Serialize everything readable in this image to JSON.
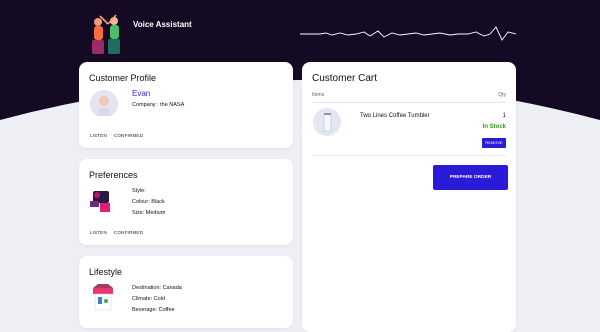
{
  "header": {
    "title": "Voice Assistant"
  },
  "profile": {
    "title": "Customer Profile",
    "name": "Evan",
    "company": "Company : the NASA",
    "actions": [
      "LISTEN",
      "CONFIRMED"
    ]
  },
  "preferences": {
    "title": "Preferences",
    "lines": [
      "Style:",
      "Colour: Black",
      "Size: Medium"
    ],
    "actions": [
      "LISTEN",
      "CONFIRMED"
    ]
  },
  "lifestyle": {
    "title": "Lifestyle",
    "lines": [
      "Destination: Canada",
      "Climate: Cold",
      "Beverage: Coffee"
    ]
  },
  "cart": {
    "title": "Customer Cart",
    "columns": {
      "items": "Items",
      "qty": "Qty"
    },
    "item": {
      "name": "Two Lines Coffee Tumbler",
      "qty": "1",
      "status": "In Stock",
      "remove_label": "REMOVE"
    },
    "prepare_label": "PREPARE ORDER"
  },
  "colors": {
    "header_dark": "#140a24",
    "accent": "#2a1bd8",
    "in_stock": "#2f9a1f",
    "name": "#2b2bd8"
  },
  "icons": [
    "brand-illustration",
    "waveform",
    "avatar-illustration",
    "clothing-illustration",
    "travel-illustration",
    "tumbler-image"
  ]
}
